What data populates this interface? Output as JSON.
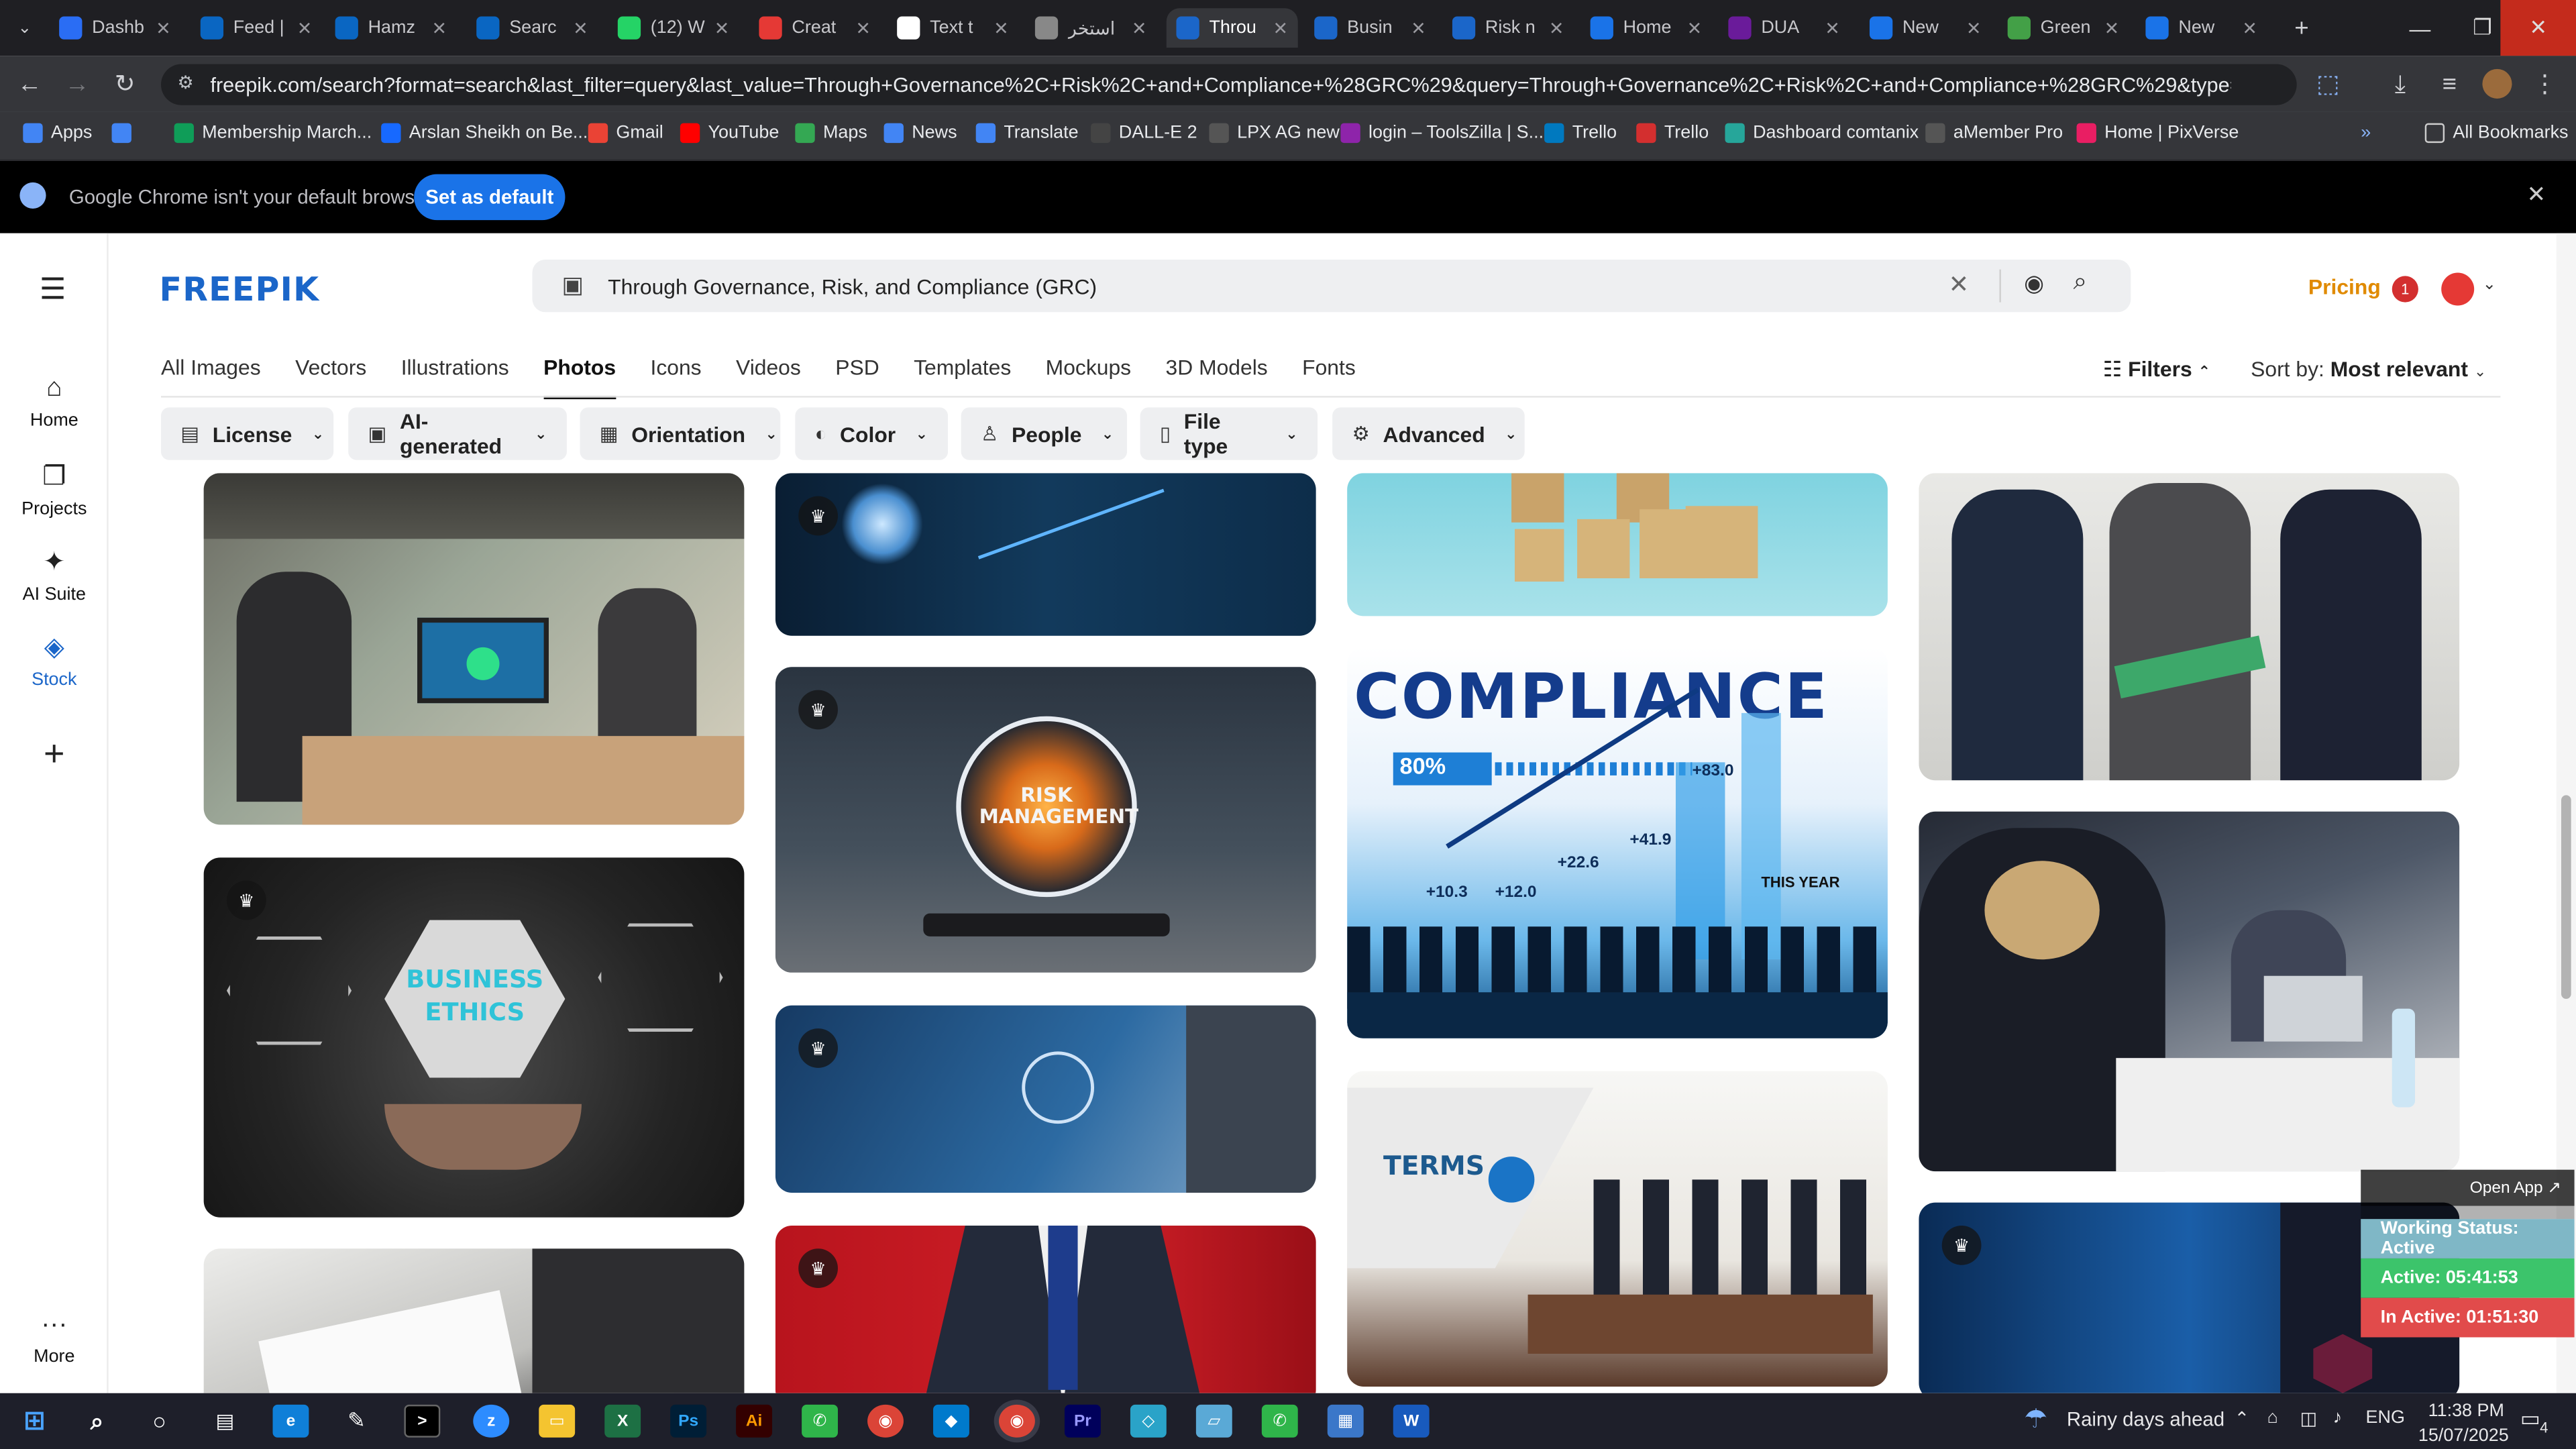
{
  "browser": {
    "tabs": [
      {
        "label": "Dashb",
        "color": "#2a6df4",
        "icon": "dashboard-icon"
      },
      {
        "label": "Feed |",
        "color": "#0a66c2",
        "icon": "linkedin-icon"
      },
      {
        "label": "Hamz",
        "color": "#0a66c2",
        "icon": "linkedin-icon"
      },
      {
        "label": "Searc",
        "color": "#0a66c2",
        "icon": "linkedin-icon"
      },
      {
        "label": "(12) W",
        "color": "#25d366",
        "icon": "whatsapp-icon"
      },
      {
        "label": "Creat",
        "color": "#e53935",
        "icon": "canva-icon"
      },
      {
        "label": "Text t",
        "color": "#ffffff",
        "icon": "text-icon"
      },
      {
        "label": "استخر",
        "color": "#888888",
        "icon": "openai-icon"
      },
      {
        "label": "Throu",
        "color": "#1b66c9",
        "icon": "freepik-icon"
      },
      {
        "label": "Busin",
        "color": "#1b66c9",
        "icon": "freepik-icon"
      },
      {
        "label": "Risk n",
        "color": "#1b66c9",
        "icon": "freepik-icon"
      },
      {
        "label": "Home",
        "color": "#1a73e8",
        "icon": "chrome-icon"
      },
      {
        "label": "DUA",
        "color": "#6a1b9a",
        "icon": "video-icon"
      },
      {
        "label": "New",
        "color": "#1a73e8",
        "icon": "chrome-icon"
      },
      {
        "label": "Green",
        "color": "#43a047",
        "icon": "green-icon"
      },
      {
        "label": "New",
        "color": "#1a73e8",
        "icon": "chrome-icon"
      }
    ],
    "url": "freepik.com/search?format=search&last_filter=query&last_value=Through+Governance%2C+Risk%2C+and+Compliance+%28GRC%29&query=Through+Governance%2C+Risk%2C+and+Compliance+%28GRC%29&type=photo",
    "bookmarks": [
      {
        "label": "Apps",
        "color": "#4285f4"
      },
      {
        "label": "",
        "color": "#4285f4"
      },
      {
        "label": "Membership March...",
        "color": "#0f9d58"
      },
      {
        "label": "Arslan Sheikh on Be...",
        "color": "#1769ff"
      },
      {
        "label": "Gmail",
        "color": "#ea4335"
      },
      {
        "label": "YouTube",
        "color": "#ff0000"
      },
      {
        "label": "Maps",
        "color": "#34a853"
      },
      {
        "label": "News",
        "color": "#4285f4"
      },
      {
        "label": "Translate",
        "color": "#4285f4"
      },
      {
        "label": "DALL-E 2",
        "color": "#444444"
      },
      {
        "label": "LPX AG new",
        "color": "#555555"
      },
      {
        "label": "login – ToolsZilla | S...",
        "color": "#8e24aa"
      },
      {
        "label": "Trello",
        "color": "#0079bf"
      },
      {
        "label": "Trello",
        "color": "#d32f2f"
      },
      {
        "label": "Dashboard comtanix",
        "color": "#26a69a"
      },
      {
        "label": "aMember Pro",
        "color": "#555555"
      },
      {
        "label": "Home | PixVerse",
        "color": "#e91e63"
      }
    ],
    "all_bookmarks": "All Bookmarks",
    "infobar": {
      "message": "Google Chrome isn't your default browser",
      "button": "Set as default"
    }
  },
  "freepik": {
    "logo": "FREEPIK",
    "search_value": "Through Governance, Risk, and Compliance (GRC)",
    "pricing": "Pricing",
    "notification_count": "1",
    "rail": [
      {
        "label": "Home",
        "icon": "home-icon"
      },
      {
        "label": "Projects",
        "icon": "projects-icon"
      },
      {
        "label": "AI Suite",
        "icon": "ai-suite-icon"
      },
      {
        "label": "Stock",
        "icon": "stock-icon"
      },
      {
        "label": "",
        "icon": "plus-icon"
      },
      {
        "label": "More",
        "icon": "more-icon"
      }
    ],
    "categories": [
      "All Images",
      "Vectors",
      "Illustrations",
      "Photos",
      "Icons",
      "Videos",
      "PSD",
      "Templates",
      "Mockups",
      "3D Models",
      "Fonts"
    ],
    "active_category": "Photos",
    "filters_label": "Filters",
    "sort_label": "Sort by:",
    "sort_value": "Most relevant",
    "filter_buttons": [
      {
        "label": "License",
        "icon": "license-icon"
      },
      {
        "label": "AI-generated",
        "icon": "ai-icon"
      },
      {
        "label": "Orientation",
        "icon": "orientation-icon"
      },
      {
        "label": "Color",
        "icon": "color-icon"
      },
      {
        "label": "People",
        "icon": "people-icon"
      },
      {
        "label": "File type",
        "icon": "file-icon"
      },
      {
        "label": "Advanced",
        "icon": "advanced-icon"
      }
    ],
    "tiles": [
      {
        "name": "office-monitor-photo",
        "premium": false,
        "text": ""
      },
      {
        "name": "digital-shield-photo",
        "premium": true,
        "text": ""
      },
      {
        "name": "compliance-blocks-photo",
        "premium": false,
        "text": ""
      },
      {
        "name": "three-businessmen-photo",
        "premium": false,
        "text": ""
      },
      {
        "name": "risk-management-photo",
        "premium": true,
        "text": "RISK MANAGEMENT"
      },
      {
        "name": "compliance-chart-photo",
        "premium": false,
        "text": "COMPLIANCE"
      },
      {
        "name": "business-ethics-photo",
        "premium": true,
        "text": "BUSINESS ETHICS"
      },
      {
        "name": "meeting-table-photo",
        "premium": false,
        "text": ""
      },
      {
        "name": "justice-icons-photo",
        "premium": true,
        "text": ""
      },
      {
        "name": "terms-meeting-photo",
        "premium": false,
        "text": "TERMS"
      },
      {
        "name": "document-hands-photo",
        "premium": false,
        "text": ""
      },
      {
        "name": "businessman-red-photo",
        "premium": true,
        "text": ""
      },
      {
        "name": "blue-tech-photo",
        "premium": true,
        "text": ""
      }
    ],
    "compliance_stats": {
      "percent": "80%",
      "v1": "+83.0",
      "v2": "+41.9",
      "v3": "+22.6",
      "v4": "+10.3",
      "v5": "+12.0",
      "year": "THIS YEAR"
    }
  },
  "working_status": {
    "open_app": "Open App ↗",
    "status": "Working Status: Active",
    "active": "Active: 05:41:53",
    "inactive": "In Active: 01:51:30"
  },
  "taskbar": {
    "weather": "Rainy days ahead",
    "lang": "ENG",
    "time": "11:38 PM",
    "date": "15/07/2025",
    "notif_count": "4"
  }
}
